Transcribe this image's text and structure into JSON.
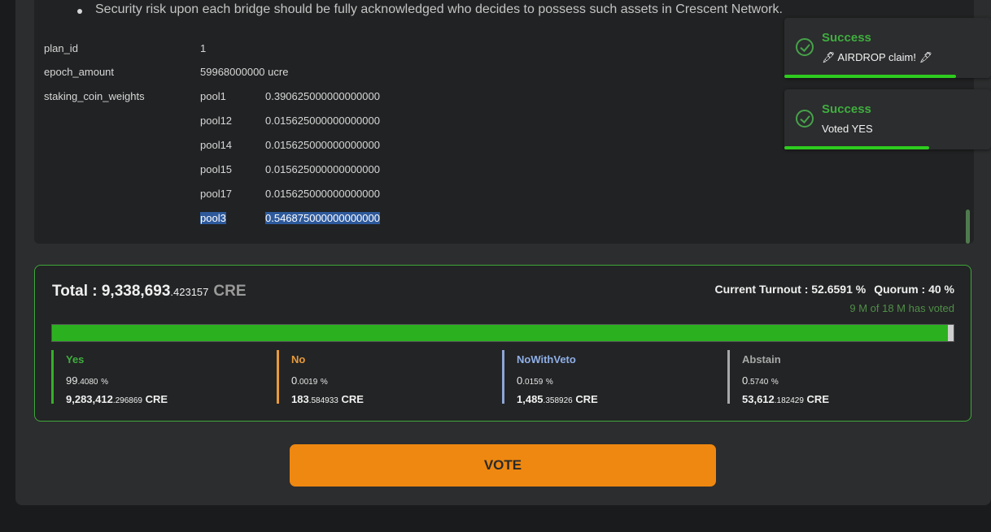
{
  "proposal": {
    "bullet": "Security risk upon each bridge should be fully acknowledged who decides to possess such assets in Crescent Network.",
    "params": [
      {
        "key": "plan_id",
        "value": "1"
      },
      {
        "key": "epoch_amount",
        "value": "59968000000 ucre"
      },
      {
        "key": "staking_coin_weights",
        "value": ""
      }
    ],
    "pools": [
      {
        "name": "pool1",
        "weight": "0.390625000000000000"
      },
      {
        "name": "pool12",
        "weight": "0.015625000000000000"
      },
      {
        "name": "pool14",
        "weight": "0.015625000000000000"
      },
      {
        "name": "pool15",
        "weight": "0.015625000000000000"
      },
      {
        "name": "pool17",
        "weight": "0.015625000000000000"
      },
      {
        "name": "pool3",
        "weight": "0.546875000000000000",
        "selected": true
      }
    ]
  },
  "toasts": [
    {
      "title": "Success",
      "message": "🖋 AIRDROP claim! 🖋",
      "progress": 0.83
    },
    {
      "title": "Success",
      "message": "Voted YES",
      "progress": 0.7
    }
  ],
  "tally": {
    "total_label": "Total : ",
    "total_int": "9,338,693",
    "total_dec": ".423157",
    "total_unit": "CRE",
    "turnout_label": "Current Turnout : 52.6591 %",
    "quorum_label": "Quorum : 40 %",
    "voted_text": "9 M of 18 M has voted",
    "yes_fraction": 0.994,
    "options": [
      {
        "name": "Yes",
        "pct_int": "99",
        "pct_dec": ".4080",
        "pct_unit": "%",
        "amt_int": "9,283,412",
        "amt_dec": ".296869",
        "amt_unit": "CRE",
        "color": "#35b02b",
        "name_color": "#3fae3f"
      },
      {
        "name": "No",
        "pct_int": "0",
        "pct_dec": ".0019",
        "pct_unit": "%",
        "amt_int": "183",
        "amt_dec": ".584933",
        "amt_unit": "CRE",
        "color": "#e89a3c",
        "name_color": "#e89a3c"
      },
      {
        "name": "NoWithVeto",
        "pct_int": "0",
        "pct_dec": ".0159",
        "pct_unit": "%",
        "amt_int": "1,485",
        "amt_dec": ".358926",
        "amt_unit": "CRE",
        "color": "#8fa5d6",
        "name_color": "#8fb0e8"
      },
      {
        "name": "Abstain",
        "pct_int": "0",
        "pct_dec": ".5740",
        "pct_unit": "%",
        "amt_int": "53,612",
        "amt_dec": ".182429",
        "amt_unit": "CRE",
        "color": "#a8a8a8",
        "name_color": "#a8a8a8"
      }
    ]
  },
  "vote_button": "VOTE"
}
